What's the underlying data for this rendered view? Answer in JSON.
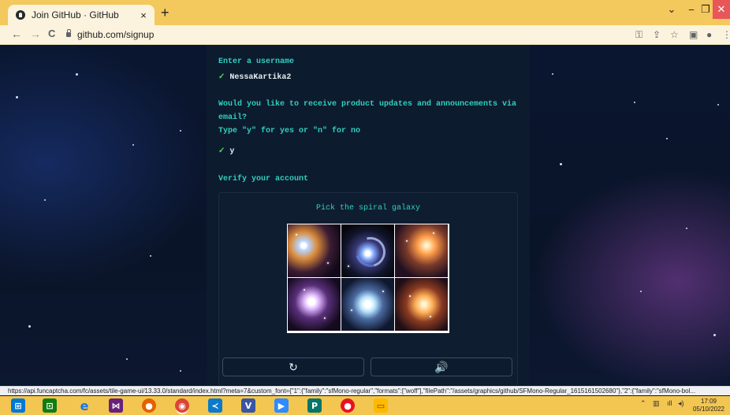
{
  "browser": {
    "tab_title": "Join GitHub · GitHub",
    "tab_close": "×",
    "new_tab": "+",
    "url": "github.com/signup",
    "nav": {
      "back": "←",
      "forward": "→",
      "reload": "C"
    },
    "window": {
      "menu": "⌄",
      "minimize": "−",
      "maximize": "❐",
      "close": "✕"
    },
    "toolbar_icons": {
      "key": "⚿",
      "share": "⇪",
      "star": "☆",
      "sidebar": "▣",
      "profile": "●",
      "menu": "⋮"
    }
  },
  "signup": {
    "username_prompt": "Enter a username",
    "check_mark": "✓",
    "username_value": "NessaKartika2",
    "updates_prompt_line1": "Would you like to receive product updates and announcements via",
    "updates_prompt_line2": "email?",
    "updates_prompt_line3": "Type \"y\" for yes or \"n\" for no",
    "updates_value": "y",
    "verify_heading": "Verify your account",
    "captcha_instruction": "Pick the spiral galaxy",
    "reload_icon": "↻",
    "audio_icon": "🔊"
  },
  "status_url": "https://api.funcaptcha.com/fc/assets/tile-game-ui/13.33.0/standard/index.html?meta=7&custom_font={\"1\":{\"family\":\"sfMono-regular\",\"formats\":[\"woff\"],\"filePath\":\"/assets/graphics/github/SFMono-Regular_1615161502680\"},\"2\":{\"family\":\"sfMono-bol...",
  "taskbar": {
    "clock_time": "17:09",
    "clock_date": "05/10/2022",
    "tray": {
      "chevron": "⌃",
      "network": "▥",
      "signal": "ıll",
      "volume": "◂)"
    },
    "icons": {
      "start": "⊞",
      "store": "⊡",
      "ie": "e",
      "visual_studio": "⋈",
      "firefox": "●",
      "chrome": "◉",
      "vscode": "≺",
      "visio": "V",
      "zoom": "▶",
      "publisher": "P",
      "paint": "●",
      "explorer": "▭"
    }
  }
}
